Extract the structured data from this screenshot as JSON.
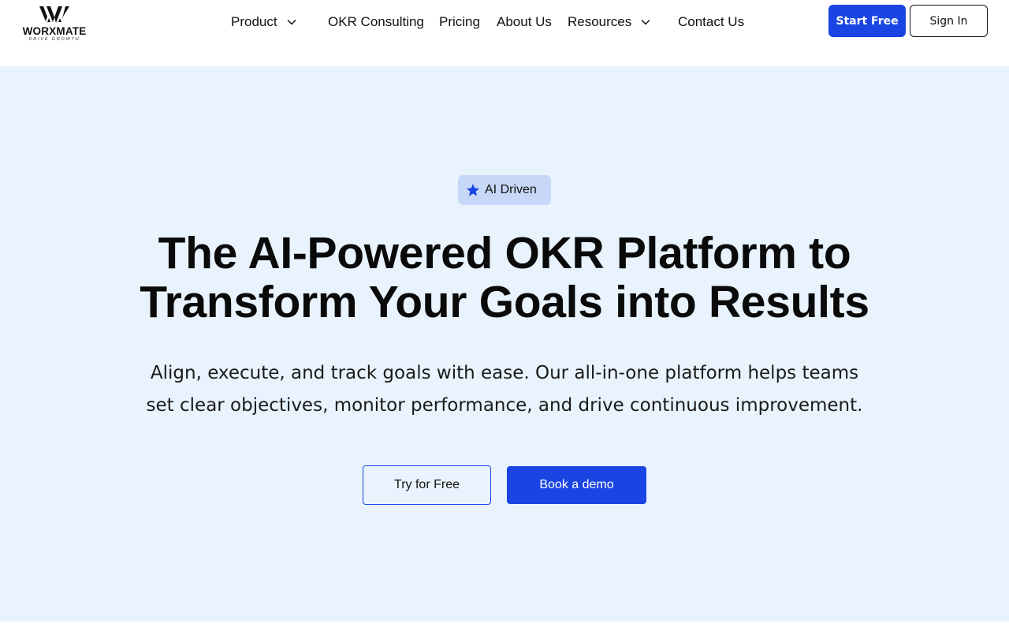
{
  "brand": {
    "name": "WORXMATE",
    "tagline": "DRIVE GROWTH"
  },
  "nav": {
    "items": [
      {
        "label": "Product",
        "has_dropdown": true
      },
      {
        "label": "OKR Consulting",
        "has_dropdown": false
      },
      {
        "label": "Pricing",
        "has_dropdown": false
      },
      {
        "label": "About Us",
        "has_dropdown": false
      },
      {
        "label": "Resources",
        "has_dropdown": true
      },
      {
        "label": "Contact Us",
        "has_dropdown": false
      }
    ]
  },
  "header_actions": {
    "start_label": "Start Free",
    "signin_label": "Sign In"
  },
  "hero": {
    "badge": {
      "icon": "star-icon",
      "label": "AI Driven"
    },
    "headline_line1": "The AI-Powered OKR Platform to",
    "headline_line2": "Transform Your Goals into Results",
    "subtext": "Align, execute, and track goals with ease. Our all-in-one platform helps teams set clear objectives, monitor performance, and drive continuous improvement.",
    "cta_secondary": "Try for Free",
    "cta_primary": "Book a demo"
  },
  "colors": {
    "accent": "#1a45e3",
    "hero_bg": "#e8f3fd",
    "badge_bg": "#c7d7f7",
    "text": "#111111"
  }
}
